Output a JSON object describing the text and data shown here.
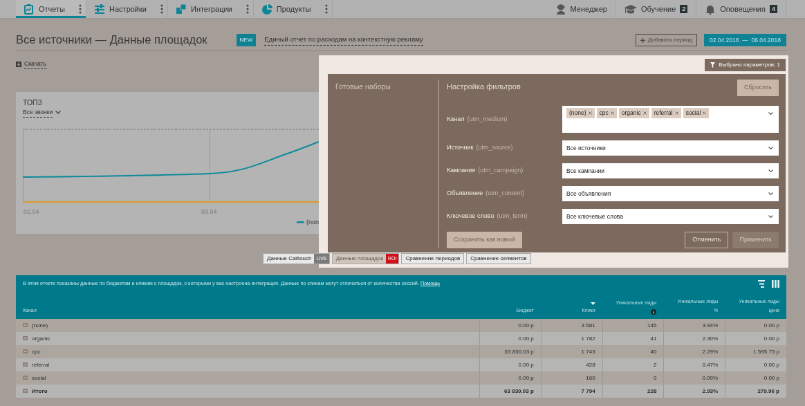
{
  "nav": {
    "items": [
      {
        "label": "Отчеты",
        "selected": true
      },
      {
        "label": "Настройки",
        "selected": false
      },
      {
        "label": "Интеграции",
        "selected": false
      },
      {
        "label": "Продукты",
        "selected": false
      }
    ],
    "right_items": [
      {
        "label": "Менеджер",
        "kind": "manager"
      },
      {
        "label": "Обучение",
        "kind": "learning",
        "count": "2"
      },
      {
        "label": "Оповещения",
        "kind": "alerts",
        "count": "4"
      }
    ]
  },
  "page": {
    "title": "Все источники — Данные площадок",
    "badge": "NEW",
    "report_link": "Единый отчет по расходам на контекстную рекламу",
    "add_period_button": "Добавить период",
    "date_range": "02.04.2018  —  06.04.2018",
    "download_link": "Скачать"
  },
  "chart_card": {
    "title": "ТОП3",
    "metric_dropdown": "Все звонки",
    "x_labels": [
      "02.04",
      "03.04"
    ],
    "legend": [
      {
        "label": "(non",
        "color": "#0e8a9b"
      }
    ]
  },
  "report_tabs": [
    {
      "label": "Данные Calltouch",
      "badge": {
        "text": "LIVE",
        "color": "#7b7b7b"
      },
      "selected": false
    },
    {
      "label": "Данные площадок",
      "badge": {
        "text": "ROI",
        "color": "#d0121b"
      },
      "selected": true
    },
    {
      "label": "Сравнение периодов",
      "selected": false
    },
    {
      "label": "Сравнение сегментов",
      "selected": false
    }
  ],
  "filter_panel": {
    "selected_count_button": "Выбрано параметров: 1",
    "presets_title": "Готовые наборы",
    "title": "Настройка фильтров",
    "reset_button": "Сбросить",
    "filters": [
      {
        "label": "Канал",
        "param": "(utm_medium)",
        "kind": "tags",
        "tags": [
          "(none)",
          "cpc",
          "organic",
          "referral",
          "social"
        ]
      },
      {
        "label": "Источник",
        "param": "(utm_source)",
        "kind": "select",
        "value": "Все источники"
      },
      {
        "label": "Кампания",
        "param": "(utm_campaign)",
        "kind": "select",
        "value": "Все кампании"
      },
      {
        "label": "Объявление",
        "param": "(utm_content)",
        "kind": "select",
        "value": "Все объявления"
      },
      {
        "label": "Ключевое слово",
        "param": "(utm_term)",
        "kind": "select",
        "value": "Все ключевые слова"
      }
    ],
    "buttons": [
      {
        "label": "Сохранить как новый",
        "kind": "secondary",
        "disabled": false
      },
      {
        "label": "Отменить",
        "kind": "outline",
        "disabled": false
      },
      {
        "label": "Применить",
        "kind": "primary",
        "disabled": true
      }
    ]
  },
  "table": {
    "info": "В этом отчете показаны данные по бюджетам и кликам с площадок, с которыми у вас настроена интеграция. Данные по кликам могут отличаться от количества сессий.",
    "help_link": "Помощь",
    "columns": [
      {
        "label": "Канал",
        "sorted": false,
        "info": false
      },
      {
        "label": "Бюджет",
        "sorted": false,
        "info": false
      },
      {
        "label": "Клики",
        "sorted": true,
        "info": false
      },
      {
        "label": "Уникальные лиды",
        "sorted": false,
        "info": true
      },
      {
        "label": "Уникальные лиды",
        "sublabel": "%",
        "sorted": false,
        "info": false
      },
      {
        "label": "Уникальные лиды",
        "sublabel": "цена",
        "sorted": false,
        "info": false
      }
    ],
    "rows": [
      {
        "cells": [
          "(none)",
          "0.00 р",
          "3 681",
          "145",
          "3.94%",
          "0.00 р"
        ]
      },
      {
        "cells": [
          "organic",
          "0.00 р",
          "1 782",
          "41",
          "2.30%",
          "0.00 р"
        ]
      },
      {
        "cells": [
          "cpc",
          "63 830.03 р",
          "1 743",
          "40",
          "2.29%",
          "1 595.75 р"
        ]
      },
      {
        "cells": [
          "referral",
          "0.00 р",
          "428",
          "2",
          "0.47%",
          "0.00 р"
        ]
      },
      {
        "cells": [
          "social",
          "0.00 р",
          "160",
          "0",
          "0.00%",
          "0.00 р"
        ]
      }
    ],
    "total": {
      "cells": [
        "Итого",
        "63 830.03 р",
        "7 794",
        "228",
        "2.93%",
        "279.96 р"
      ]
    }
  }
}
